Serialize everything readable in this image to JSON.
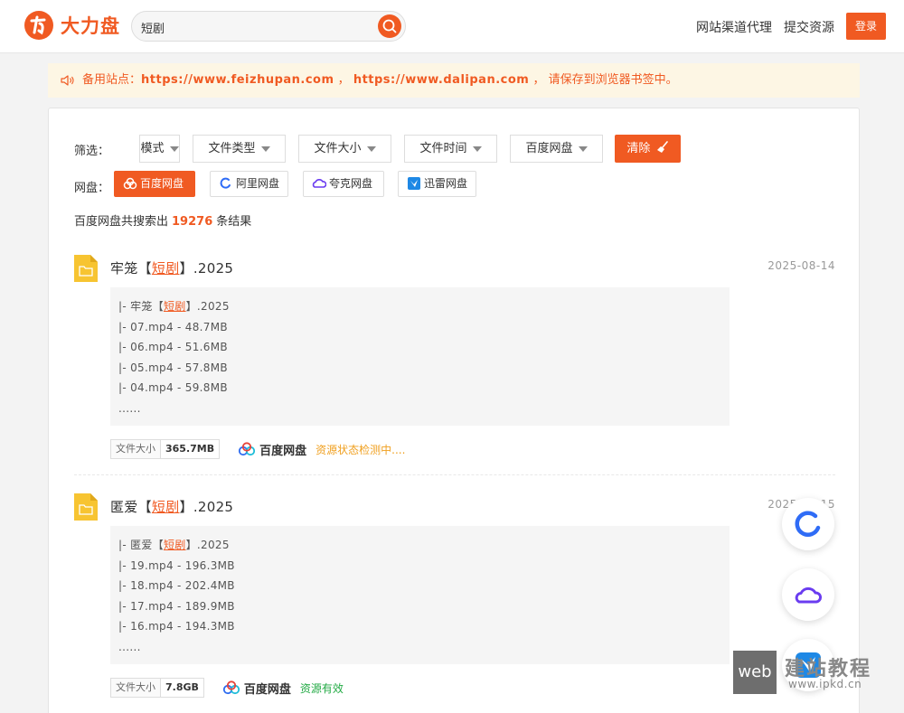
{
  "header": {
    "logo_text": "大力盘",
    "search_value": "短剧",
    "nav": [
      "网站渠道代理",
      "提交资源"
    ],
    "login_label": "登录"
  },
  "notice": {
    "prefix": "备用站点：",
    "url1": "https://www.feizhupan.com",
    "sep": " ， ",
    "url2": "https://www.dalipan.com",
    "suffix": " ， 请保存到浏览器书签中。"
  },
  "filters": {
    "label": "筛选：",
    "dropdowns": [
      "模式",
      "文件类型",
      "文件大小",
      "文件时间",
      "百度网盘"
    ],
    "clear_label": "清除"
  },
  "pans": {
    "label": "网盘：",
    "items": [
      "百度网盘",
      "阿里网盘",
      "夸克网盘",
      "迅雷网盘"
    ],
    "active": "百度网盘"
  },
  "result_count": {
    "prefix": "百度网盘共搜索出",
    "count": "19276",
    "suffix": "条结果"
  },
  "results": [
    {
      "title_pre": "牢笼【",
      "title_hl": "短剧",
      "title_post": "】.2025",
      "date": "2025-08-14",
      "lines": [
        {
          "pre": "|- 牢笼【",
          "hl": "短剧",
          "post": "】.2025"
        },
        {
          "pre": "|- 07.mp4 - 48.7MB",
          "hl": "",
          "post": ""
        },
        {
          "pre": "|- 06.mp4 - 51.6MB",
          "hl": "",
          "post": ""
        },
        {
          "pre": "|- 05.mp4 - 57.8MB",
          "hl": "",
          "post": ""
        },
        {
          "pre": "|- 04.mp4 - 59.8MB",
          "hl": "",
          "post": ""
        },
        {
          "pre": "......",
          "hl": "",
          "post": ""
        }
      ],
      "size_label": "文件大小",
      "size": "365.7MB",
      "pan": "百度网盘",
      "status": "资源状态检测中....",
      "status_color": "#f0a020"
    },
    {
      "title_pre": "匿爱【",
      "title_hl": "短剧",
      "title_post": "】.2025",
      "date": "2025-08-15",
      "lines": [
        {
          "pre": "|- 匿爱【",
          "hl": "短剧",
          "post": "】.2025"
        },
        {
          "pre": "|- 19.mp4 - 196.3MB",
          "hl": "",
          "post": ""
        },
        {
          "pre": "|- 18.mp4 - 202.4MB",
          "hl": "",
          "post": ""
        },
        {
          "pre": "|- 17.mp4 - 189.9MB",
          "hl": "",
          "post": ""
        },
        {
          "pre": "|- 16.mp4 - 194.3MB",
          "hl": "",
          "post": ""
        },
        {
          "pre": "......",
          "hl": "",
          "post": ""
        }
      ],
      "size_label": "文件大小",
      "size": "7.8GB",
      "pan": "百度网盘",
      "status": "资源有效",
      "status_color": "#22aa44"
    }
  ],
  "watermark": {
    "box": "web",
    "title": "建站教程",
    "url": "www.ipkd.cn"
  },
  "colors": {
    "accent": "#f05a22"
  }
}
